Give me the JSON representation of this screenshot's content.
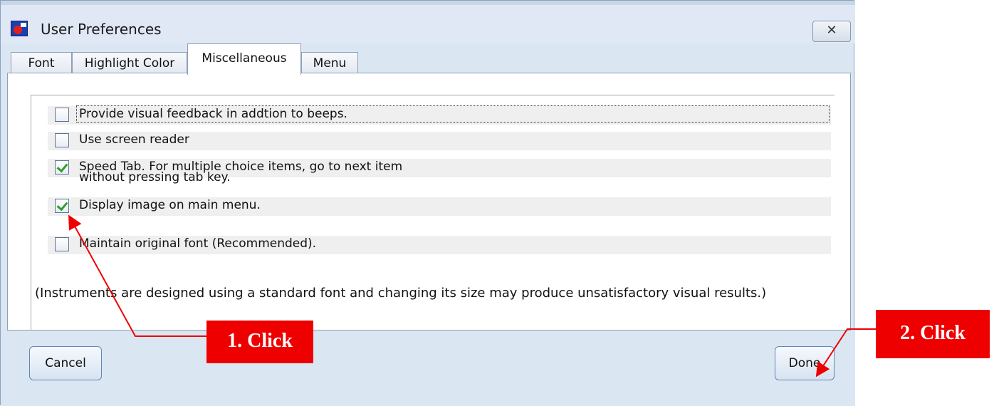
{
  "window": {
    "title": "User Preferences",
    "close_label": "✕"
  },
  "tabs": [
    "Font",
    "Highlight Color",
    "Miscellaneous",
    "Menu"
  ],
  "options": [
    {
      "label": "Provide visual feedback in addtion to beeps.",
      "checked": false
    },
    {
      "label": "Use screen reader",
      "checked": false
    },
    {
      "label": "Speed Tab. For multiple choice items, go to next item",
      "label2": "without pressing tab key.",
      "checked": true
    },
    {
      "label": "Display image on main menu.",
      "checked": true
    },
    {
      "label": "Maintain original font (Recommended).",
      "checked": false
    }
  ],
  "note": "(Instruments are designed using a standard font and changing its size may produce unsatisfactory visual results.)",
  "buttons": {
    "cancel": "Cancel",
    "done": "Done"
  },
  "callouts": {
    "first": "1. Click",
    "second": "2. Click",
    "color": "#ee0000"
  }
}
